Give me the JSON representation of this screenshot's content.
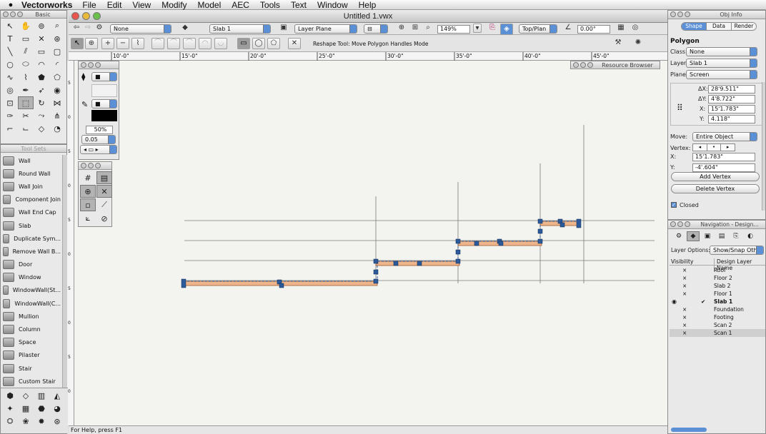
{
  "menubar": {
    "app": "Vectorworks",
    "items": [
      "File",
      "Edit",
      "View",
      "Modify",
      "Model",
      "AEC",
      "Tools",
      "Text",
      "Window",
      "Help"
    ]
  },
  "document": {
    "title": "Untitled 1.vwx"
  },
  "viewbar": {
    "class": "None",
    "layer": "Slab 1",
    "layer_plane": "Layer Plane",
    "zoom": "149%",
    "view": "Top/Plan",
    "angle": "0.00°"
  },
  "modebar": {
    "hint": "Reshape Tool: Move Polygon Handles Mode"
  },
  "basic_palette": {
    "title": "Basic"
  },
  "toolsets_palette": {
    "title": "Tool Sets",
    "items": [
      "Wall",
      "Round Wall",
      "Wall Join",
      "Component Join",
      "Wall End Cap",
      "Slab",
      "Duplicate Sym...",
      "Remove Wall B...",
      "Door",
      "Window",
      "WindowWall(St...",
      "WindowWall(C...",
      "Mullion",
      "Column",
      "Space",
      "Pilaster",
      "Stair",
      "Custom Stair"
    ]
  },
  "attributes_palette": {
    "opacity": "50%",
    "line_weight": "0.05"
  },
  "resource_browser": {
    "title": "Resource Browser"
  },
  "ruler": {
    "labels": [
      "10'-0\"",
      "15'-0\"",
      "20'-0\"",
      "25'-0\"",
      "30'-0\"",
      "35'-0\"",
      "40'-0\"",
      "45'-0\""
    ],
    "side_labels": [
      "5",
      "0",
      "5",
      "0",
      "5",
      "0",
      "5",
      "0",
      "5",
      "0"
    ]
  },
  "obj_info": {
    "title": "Obj Info",
    "tabs": [
      "Shape",
      "Data",
      "Render"
    ],
    "object_type": "Polygon",
    "class_label": "Class:",
    "class_value": "None",
    "layer_label": "Layer:",
    "layer_value": "Slab 1",
    "plane_label": "Plane:",
    "plane_value": "Screen",
    "dx_label": "ΔX:",
    "dx": "28'9.511\"",
    "dy_label": "ΔY:",
    "dy": "4'8.722\"",
    "x_label": "X:",
    "x": "15'1.783\"",
    "y_label": "Y:",
    "y": "4.118\"",
    "move_label": "Move:",
    "move_value": "Entire Object",
    "vertex_label": "Vertex:",
    "vx_label": "X:",
    "vx": "15'1.783\"",
    "vy_label": "Y:",
    "vy": "-4'.604\"",
    "add_vertex": "Add Vertex",
    "delete_vertex": "Delete Vertex",
    "closed_label": "Closed"
  },
  "navigation": {
    "title": "Navigation - Design...",
    "layer_options_label": "Layer Options:",
    "layer_options_value": "Show/Snap Others",
    "col_visibility": "Visibility",
    "col_name": "Design Layer Name",
    "layers": [
      {
        "name": "Roof",
        "vis": "×"
      },
      {
        "name": "Floor 2",
        "vis": "×"
      },
      {
        "name": "Slab 2",
        "vis": "×"
      },
      {
        "name": "Floor 1",
        "vis": "×"
      },
      {
        "name": "Slab 1",
        "vis": "✔"
      },
      {
        "name": "Foundation",
        "vis": "×"
      },
      {
        "name": "Footing",
        "vis": "×"
      },
      {
        "name": "Scan 2",
        "vis": "×"
      },
      {
        "name": "Scan 1",
        "vis": "×"
      }
    ]
  },
  "status": {
    "help": "For Help, press F1"
  },
  "colors": {
    "canvas": "#f3f3ef",
    "wall_fill": "#e9a77a",
    "selection": "#2c5a9a",
    "accent": "#5b8fd6"
  }
}
